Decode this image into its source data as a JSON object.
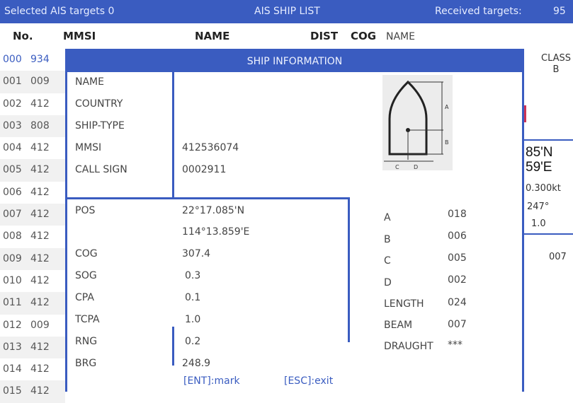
{
  "topbar": {
    "selected": "Selected AIS targets 0",
    "title": "AIS SHIP LIST",
    "received_label": "Received targets:",
    "received_count": "95"
  },
  "columns": {
    "no": "No.",
    "mmsi": "MMSI",
    "name": "NAME",
    "dist": "DIST",
    "cog": "COG",
    "name_right": "NAME"
  },
  "rows": [
    {
      "no": "000",
      "mmsi": "934"
    },
    {
      "no": "001",
      "mmsi": "009"
    },
    {
      "no": "002",
      "mmsi": "412"
    },
    {
      "no": "003",
      "mmsi": "808"
    },
    {
      "no": "004",
      "mmsi": "412"
    },
    {
      "no": "005",
      "mmsi": "412"
    },
    {
      "no": "006",
      "mmsi": "412"
    },
    {
      "no": "007",
      "mmsi": "412"
    },
    {
      "no": "008",
      "mmsi": "412"
    },
    {
      "no": "009",
      "mmsi": "412"
    },
    {
      "no": "010",
      "mmsi": "412"
    },
    {
      "no": "011",
      "mmsi": "412"
    },
    {
      "no": "012",
      "mmsi": "009"
    },
    {
      "no": "013",
      "mmsi": "412"
    },
    {
      "no": "014",
      "mmsi": "412"
    },
    {
      "no": "015",
      "mmsi": "412"
    }
  ],
  "right_panel": {
    "class_label": "CLASS",
    "class_value": "B",
    "lat": "85'N",
    "lon": "59'E",
    "sog": "0.300kt",
    "cog": "247°",
    "cpa": "1.0",
    "beam": "007"
  },
  "modal": {
    "title": "SHIP INFORMATION",
    "labels": {
      "name": "NAME",
      "country": "COUNTRY",
      "ship_type": "SHIP-TYPE",
      "mmsi": "MMSI",
      "call_sign": "CALL SIGN",
      "pos": "POS",
      "cog": "COG",
      "sog": "SOG",
      "cpa": "CPA",
      "tcpa": "TCPA",
      "rng": "RNG",
      "brg": "BRG"
    },
    "values": {
      "mmsi": "412536074",
      "call_sign": "0002911",
      "lat": "22°17.085'N",
      "lon": "114°13.859'E",
      "cog": "307.4",
      "sog": "0.3",
      "cpa": "0.1",
      "tcpa": "1.0",
      "rng": "0.2",
      "brg": "248.9"
    },
    "dims": [
      {
        "label": "A",
        "value": "018"
      },
      {
        "label": "B",
        "value": "006"
      },
      {
        "label": "C",
        "value": "005"
      },
      {
        "label": "D",
        "value": "002"
      },
      {
        "label": "LENGTH",
        "value": "024"
      },
      {
        "label": "BEAM",
        "value": "007"
      },
      {
        "label": "DRAUGHT",
        "value": "***"
      }
    ],
    "diagram_labels": {
      "a": "A",
      "b": "B",
      "c": "C",
      "d": "D"
    },
    "footer": {
      "mark": "[ENT]:mark",
      "exit": "[ESC]:exit"
    }
  },
  "colors": {
    "accent": "#3a5cc0",
    "alert": "#cc3355"
  }
}
